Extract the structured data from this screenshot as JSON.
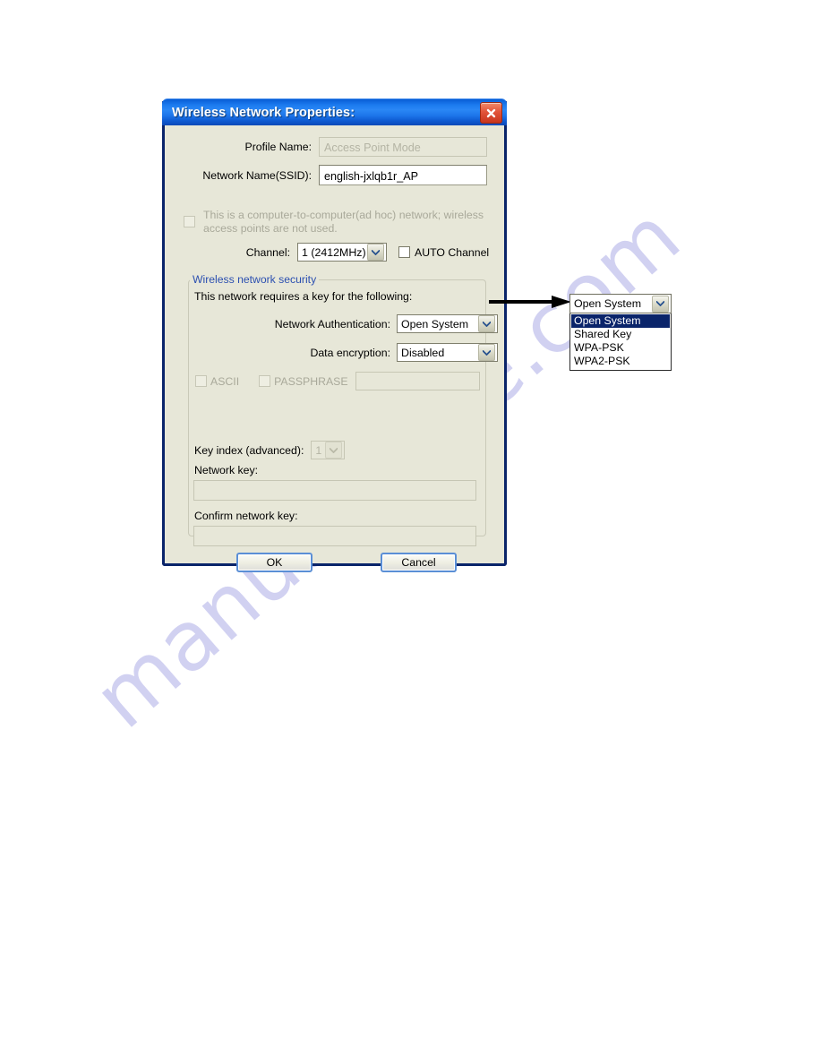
{
  "watermark": {
    "text": "manualshive.com"
  },
  "dialog": {
    "title": "Wireless Network Properties:",
    "close_icon": "close-x-icon",
    "profile": {
      "label": "Profile Name:",
      "value": "Access Point Mode",
      "disabled": true
    },
    "ssid": {
      "label": "Network Name(SSID):",
      "value": "english-jxlqb1r_AP"
    },
    "adhoc": {
      "label_line1": "This is a computer-to-computer(ad hoc) network; wireless",
      "label_line2": "access points are not used.",
      "checked": false,
      "disabled": true
    },
    "channel": {
      "label": "Channel:",
      "value": "1  (2412MHz)",
      "auto_label": "AUTO Channel",
      "auto_checked": false
    },
    "security_group": {
      "legend": "Wireless network security",
      "intro": "This network requires a key for the following:",
      "network_auth": {
        "label": "Network Authentication:",
        "value": "Open System"
      },
      "data_encryption": {
        "label": "Data encryption:",
        "value": "Disabled"
      },
      "ascii": {
        "label": "ASCII",
        "checked": false,
        "disabled": true
      },
      "passphrase": {
        "label": "PASSPHRASE",
        "checked": false,
        "disabled": true
      },
      "passphrase_input": {
        "value": "",
        "disabled": true
      },
      "key_index": {
        "label": "Key index (advanced):",
        "value": "1",
        "disabled": true
      },
      "network_key": {
        "label": "Network key:",
        "value": ""
      },
      "confirm_key": {
        "label": "Confirm network key:",
        "value": ""
      }
    },
    "buttons": {
      "ok": "OK",
      "cancel": "Cancel"
    }
  },
  "expanded_dropdown": {
    "selected": "Open System",
    "arrow_icon": "chevron-down-icon",
    "options": [
      {
        "label": "Open System",
        "selected": true
      },
      {
        "label": "Shared Key",
        "selected": false
      },
      {
        "label": "WPA-PSK",
        "selected": false
      },
      {
        "label": "WPA2-PSK",
        "selected": false
      }
    ]
  },
  "colors": {
    "titlebar_blue": "#1c7bef",
    "dialog_face": "#e7e7d8",
    "border_blue": "#0a246a",
    "legend_blue": "#2b4fb0",
    "highlight_blue": "#0a246a",
    "close_red": "#c8351c",
    "watermark": "#c9c9ef"
  }
}
